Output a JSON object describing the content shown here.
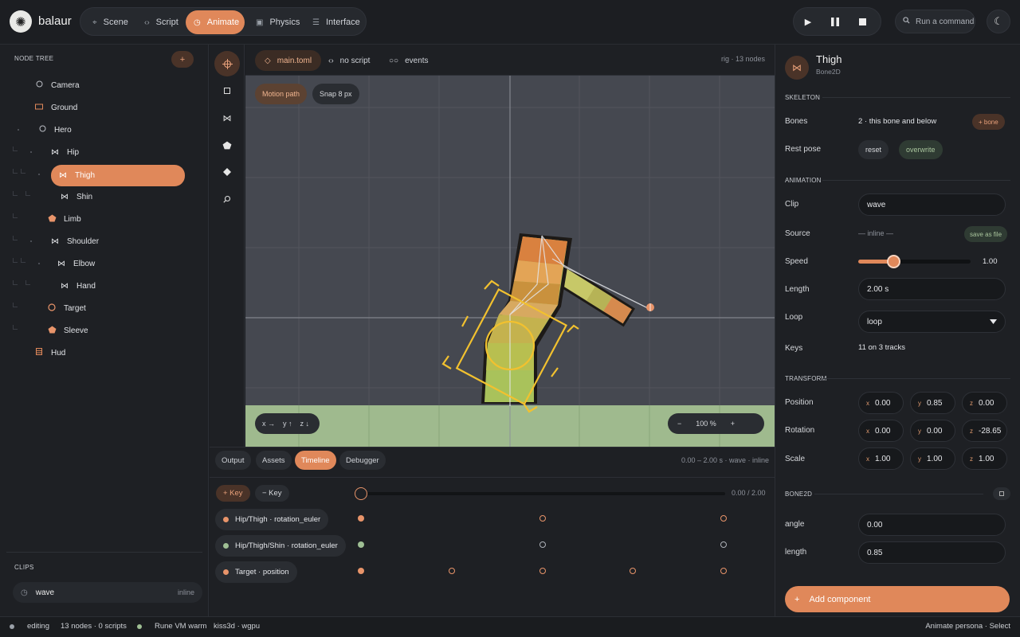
{
  "app": {
    "name": "balaur"
  },
  "modes": [
    {
      "icon": "⌖",
      "label": "Scene"
    },
    {
      "icon": "‹›",
      "label": "Script"
    },
    {
      "icon": "◷",
      "label": "Animate"
    },
    {
      "icon": "▣",
      "label": "Physics"
    },
    {
      "icon": "☰",
      "label": "Interface"
    }
  ],
  "command": {
    "label": "Run a command"
  },
  "node_tree": {
    "title": "NODE TREE",
    "add": "+",
    "nodes": [
      {
        "label": "Camera",
        "icon": "circle"
      },
      {
        "label": "Ground",
        "icon": "rect"
      },
      {
        "label": "Hero",
        "icon": "circle"
      },
      {
        "label": "Hip",
        "icon": "bone"
      },
      {
        "label": "Thigh",
        "icon": "bone"
      },
      {
        "label": "Shin",
        "icon": "bone"
      },
      {
        "label": "Limb",
        "icon": "pentagon"
      },
      {
        "label": "Shoulder",
        "icon": "bone"
      },
      {
        "label": "Elbow",
        "icon": "bone"
      },
      {
        "label": "Hand",
        "icon": "bone"
      },
      {
        "label": "Target",
        "icon": "circle-orange"
      },
      {
        "label": "Sleeve",
        "icon": "pentagon"
      },
      {
        "label": "Hud",
        "icon": "list"
      }
    ]
  },
  "clips": {
    "title": "CLIPS",
    "items": [
      {
        "name": "wave",
        "tag": "inline"
      }
    ]
  },
  "editor_tabs": [
    {
      "icon": "◇",
      "label": "main.toml"
    },
    {
      "icon": "‹›",
      "label": "no script"
    },
    {
      "icon": "○○",
      "label": "events"
    }
  ],
  "editor_info": "rig · 13 nodes",
  "viewport": {
    "motion_path": "Motion path",
    "snap": "Snap 8 px",
    "axes": {
      "x": "x →",
      "y": "y ↑",
      "z": "z ↓"
    },
    "zoom": {
      "minus": "−",
      "value": "100 %",
      "plus": "+"
    }
  },
  "bottom_tabs": [
    "Output",
    "Assets",
    "Timeline",
    "Debugger"
  ],
  "bottom_info": "0.00 – 2.00 s · wave · inline",
  "timeline": {
    "add_key": "+ Key",
    "remove_key": "− Key",
    "time": "0.00 / 2.00",
    "playhead": 0.0,
    "tracks": [
      {
        "label": "Hip/Thigh · rotation_euler",
        "color": "#e8946a",
        "keys": [
          0.0,
          1.0,
          2.0
        ]
      },
      {
        "label": "Hip/Thigh/Shin · rotation_euler",
        "color": "#9fbf94",
        "keys": [
          0.0,
          1.0,
          2.0
        ]
      },
      {
        "label": "Target · position",
        "color": "#e8946a",
        "keys": [
          0.0,
          0.5,
          1.0,
          1.5,
          2.0
        ]
      }
    ]
  },
  "inspector": {
    "name": "Thigh",
    "type": "Bone2D",
    "skeleton": {
      "title": "SKELETON",
      "bones_label": "Bones",
      "bones_value": "2 · this bone and below",
      "add_bone": "+ bone",
      "rest_pose_label": "Rest pose",
      "reset": "reset",
      "overwrite": "overwrite"
    },
    "animation": {
      "title": "ANIMATION",
      "clip_label": "Clip",
      "clip_value": "wave",
      "source_label": "Source",
      "source_value": "— inline —",
      "save_as_file": "save as file",
      "speed_label": "Speed",
      "speed_value": "1.00",
      "speed_fraction": 0.31,
      "length_label": "Length",
      "length_value": "2.00 s",
      "loop_label": "Loop",
      "loop_value": "loop",
      "keys_label": "Keys",
      "keys_value": "11 on 3 tracks"
    },
    "transform": {
      "title": "TRANSFORM",
      "position_label": "Position",
      "position": [
        "0.00",
        "0.85",
        "0.00"
      ],
      "rotation_label": "Rotation",
      "rotation": [
        "0.00",
        "0.00",
        "-28.65"
      ],
      "scale_label": "Scale",
      "scale": [
        "1.00",
        "1.00",
        "1.00"
      ]
    },
    "bone2d": {
      "title": "BONE2D",
      "angle_label": "angle",
      "angle_value": "0.00",
      "length_label": "length",
      "length_value": "0.85"
    },
    "add_component": "Add component"
  },
  "status": {
    "mode": "editing",
    "counts": "13 nodes · 0 scripts",
    "vm": "Rune VM warm",
    "renderer": "kiss3d · wgpu",
    "persona": "Animate persona · Select"
  },
  "colors": {
    "accent": "#e0885a",
    "bg": "#1c1e22",
    "panel": "#1e2024",
    "viewport": "#454850",
    "ground": "#9fba8e",
    "ok": "#9fbf94"
  }
}
